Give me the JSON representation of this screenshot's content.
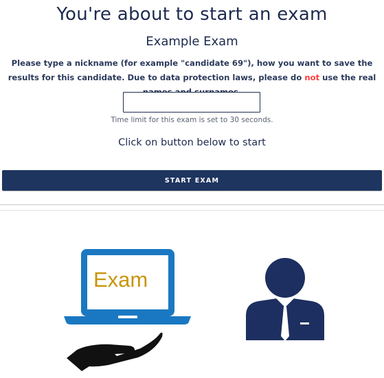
{
  "header": {
    "title": "You're about to start an exam",
    "exam_name": "Example Exam"
  },
  "instructions": {
    "part1": "Please type a nickname (for example \"candidate 69\"), how you want to save the results for this candidate. Due to data protection laws, please do ",
    "highlight": "not",
    "part2": " use the real names and surnames."
  },
  "nickname_input": {
    "value": "",
    "placeholder": ""
  },
  "time_limit_text": "Time limit for this exam is set to 30 seconds.",
  "click_instruction": "Click on button below to start",
  "start_button_label": "START EXAM",
  "illustration": {
    "laptop_screen_text": "Exam",
    "icons": [
      "laptop-icon",
      "hand-icon",
      "person-icon"
    ]
  },
  "colors": {
    "primary": "#1e3560",
    "laptop_blue": "#1a78c2",
    "exam_text": "#c8960c",
    "warning_red": "#ff3b3b",
    "person_navy": "#1d2f60"
  }
}
